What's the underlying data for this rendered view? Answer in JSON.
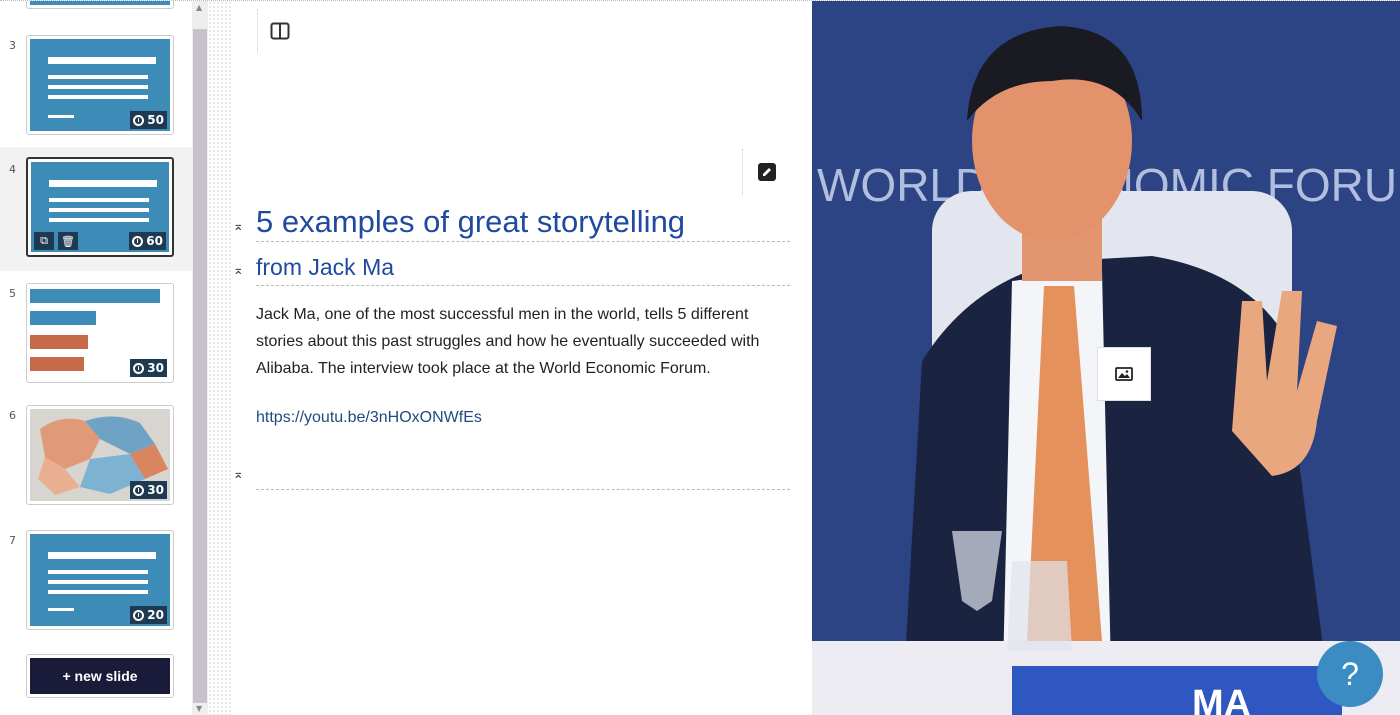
{
  "sidebar": {
    "slides": [
      {
        "number": "3",
        "timer": "50",
        "kind": "text"
      },
      {
        "number": "4",
        "timer": "60",
        "kind": "text",
        "selected": true
      },
      {
        "number": "5",
        "timer": "30",
        "kind": "chart"
      },
      {
        "number": "6",
        "timer": "30",
        "kind": "map"
      },
      {
        "number": "7",
        "timer": "20",
        "kind": "text"
      }
    ],
    "new_slide_label": "+ new slide"
  },
  "editor": {
    "title": "5 examples of great storytelling",
    "subtitle": "from Jack Ma",
    "body": "Jack Ma, one of the most successful men in the world, tells 5 different stories about this past struggles and how he eventually succeeded with Alibaba. The interview took place at the World Economic Forum.",
    "link": "https://youtu.be/3nHOxONWfEs"
  },
  "image_panel": {
    "backdrop_text": "WORLD ECONOMIC FORUM",
    "nameplate": "MA"
  },
  "help": {
    "label": "?"
  },
  "colors": {
    "accent": "#1f4aa0",
    "thumb_bg": "#3d8cb8",
    "help_bg": "#3c8cc4"
  },
  "icons": [
    "layout-columns-icon",
    "pencil-icon",
    "image-icon",
    "collapse-icon",
    "clock-icon",
    "copy-icon",
    "trash-icon"
  ]
}
